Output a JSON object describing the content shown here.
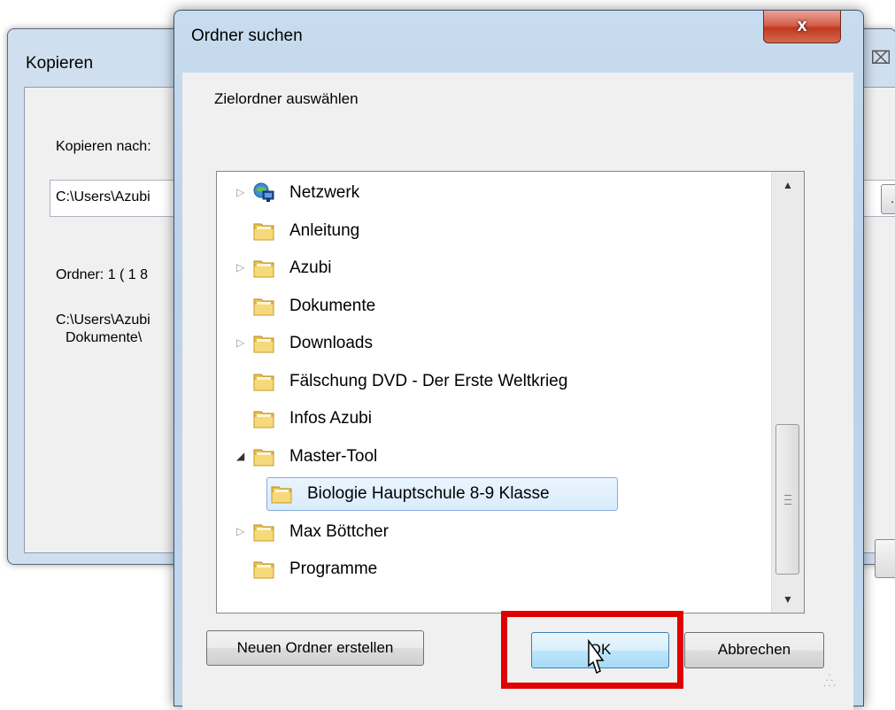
{
  "background_dialog": {
    "title": "Kopieren",
    "copy_to_label": "Kopieren nach:",
    "path_value": "C:\\Users\\Azubi",
    "browse_label": "...",
    "folder_info": "Ordner: 1    ( 1 8",
    "path_line1": "C:\\Users\\Azubi",
    "path_line2": "Dokumente\\"
  },
  "dialog": {
    "title": "Ordner suchen",
    "close_glyph": "x",
    "description": "Zielordner auswählen"
  },
  "tree": {
    "items": [
      {
        "label": "Netzwerk",
        "icon": "network-icon",
        "arrow": "collapsed"
      },
      {
        "label": "Anleitung",
        "icon": "folder-icon",
        "arrow": "none"
      },
      {
        "label": "Azubi",
        "icon": "folder-icon",
        "arrow": "collapsed"
      },
      {
        "label": "Dokumente",
        "icon": "folder-icon",
        "arrow": "none"
      },
      {
        "label": "Downloads",
        "icon": "folder-icon",
        "arrow": "collapsed"
      },
      {
        "label": "Fälschung DVD - Der Erste Weltkrieg",
        "icon": "folder-icon",
        "arrow": "none"
      },
      {
        "label": "Infos Azubi",
        "icon": "folder-icon",
        "arrow": "none"
      },
      {
        "label": "Master-Tool",
        "icon": "folder-icon",
        "arrow": "expanded"
      },
      {
        "label": "Biologie Hauptschule 8-9 Klasse",
        "icon": "folder-icon",
        "arrow": "none",
        "selected": true
      },
      {
        "label": "Max Böttcher",
        "icon": "folder-icon",
        "arrow": "collapsed"
      },
      {
        "label": "Programme",
        "icon": "folder-icon",
        "arrow": "none"
      }
    ]
  },
  "buttons": {
    "new_folder": "Neuen Ordner erstellen",
    "ok": "OK",
    "cancel": "Abbrechen"
  },
  "colors": {
    "highlight": "#e00000",
    "selection_border": "#84acdd",
    "close_button": "#c0391f"
  }
}
